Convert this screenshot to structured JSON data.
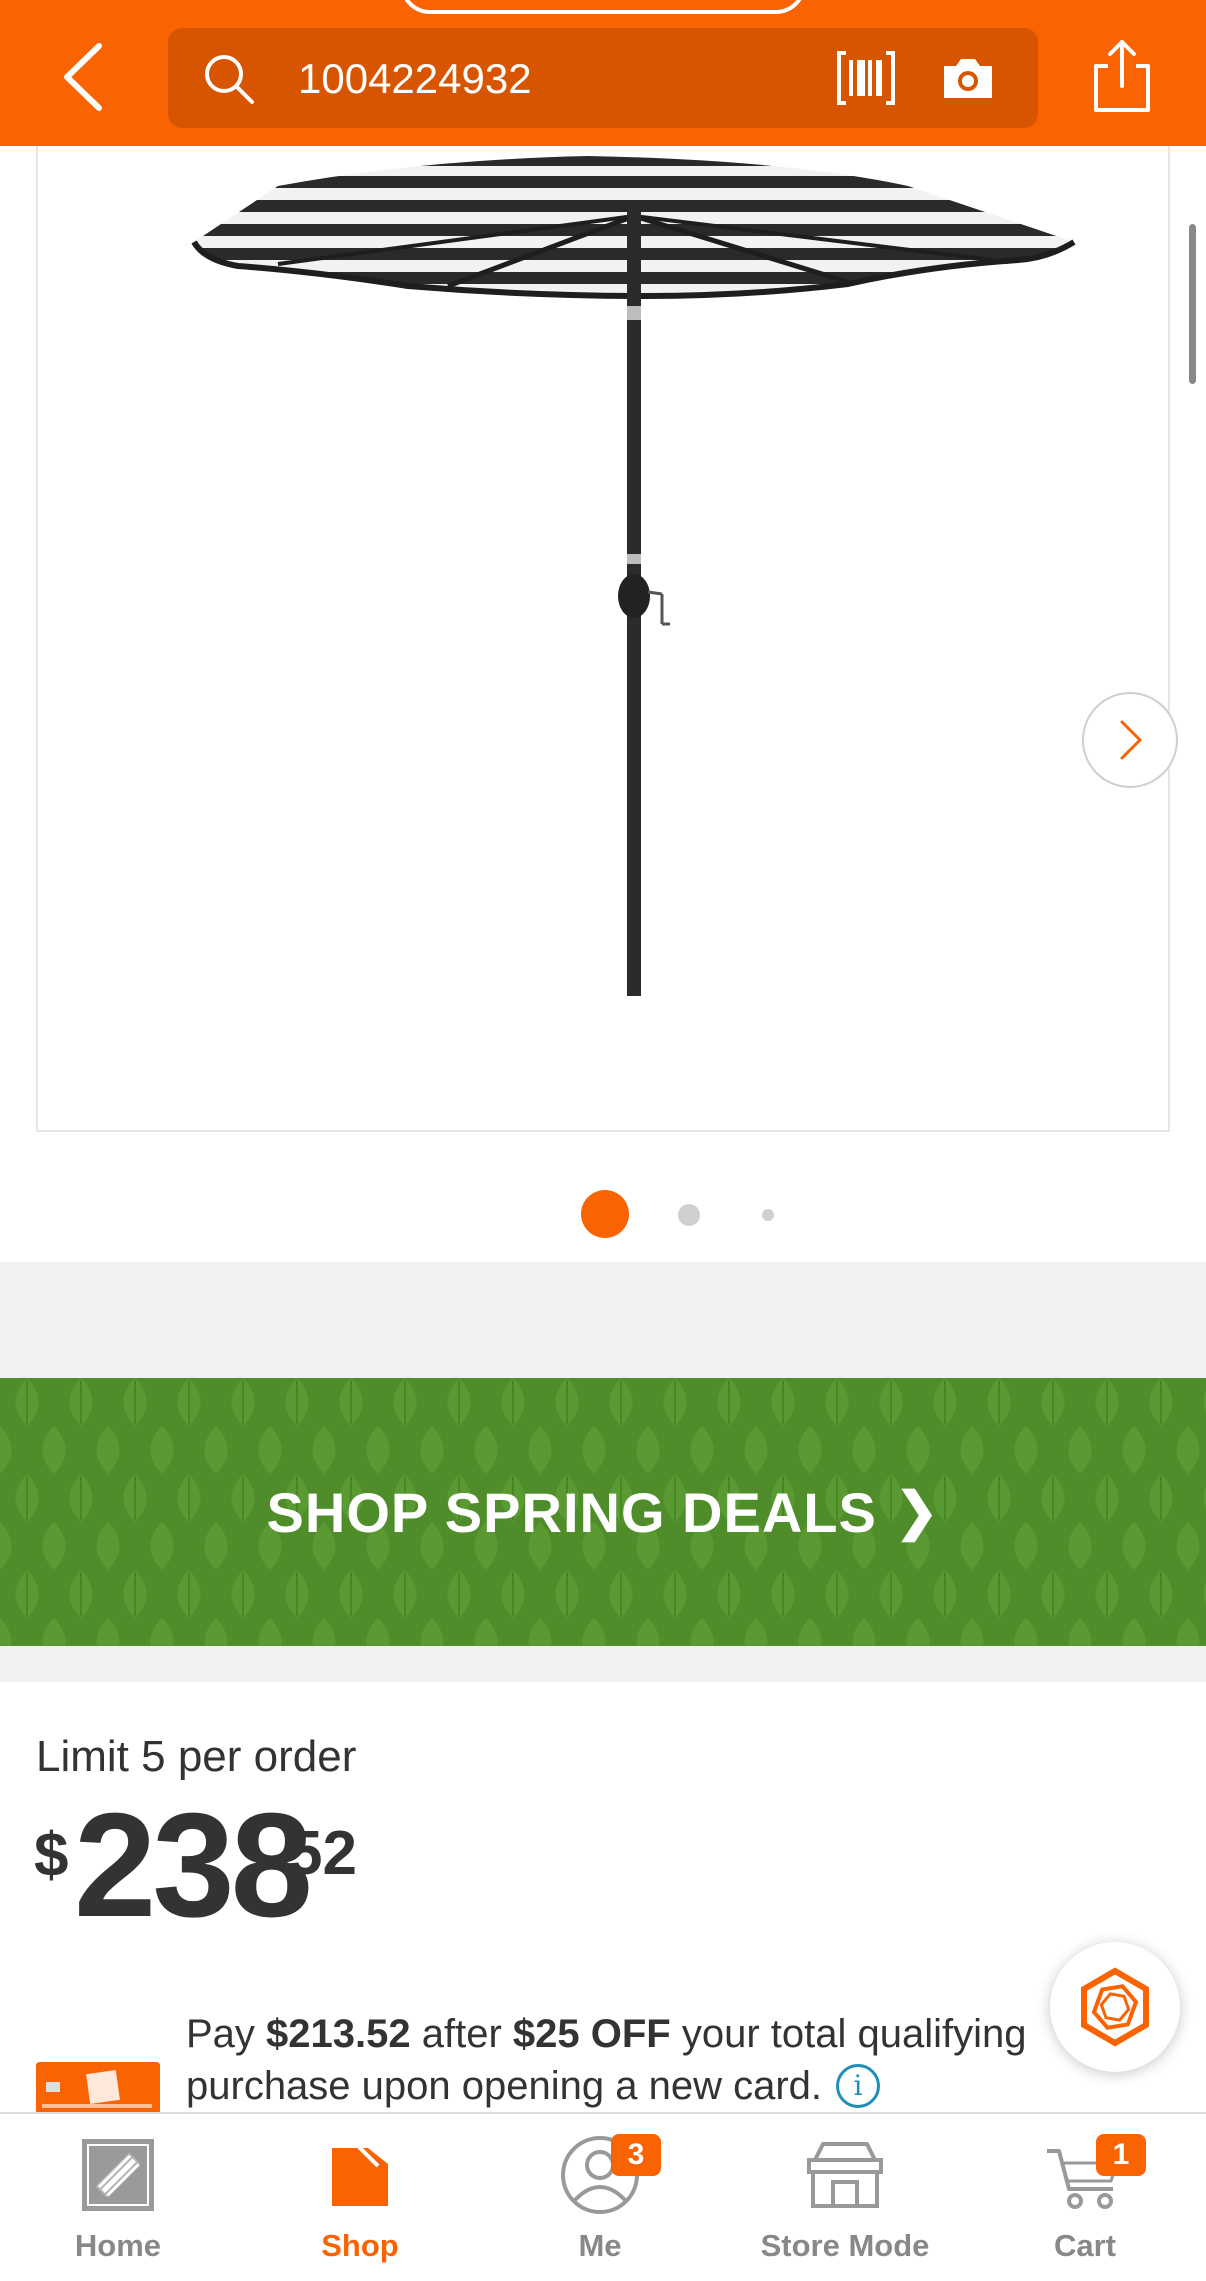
{
  "header": {
    "search_query": "1004224932",
    "accent_color": "#f96302",
    "icons": [
      "back-chevron-icon",
      "search-icon",
      "barcode-icon",
      "camera-icon",
      "share-icon"
    ]
  },
  "gallery": {
    "current_image": 1,
    "image_count": 3,
    "next_icon": "chevron-right-icon"
  },
  "promo": {
    "label": "SHOP SPRING DEALS",
    "chevron": "❯",
    "background_color": "#4f8c2a"
  },
  "price_section": {
    "limit_text": "Limit 5 per order",
    "price_symbol": "$",
    "price_dollars": "238",
    "price_cents": "52",
    "offer": {
      "pay_prefix": "Pay ",
      "pay_amount": "$213.52",
      "after_text": " after ",
      "discount": "$25 OFF",
      "tail_text": " your total qualifying",
      "line2": "purchase upon opening a new card."
    }
  },
  "bottom_nav": {
    "items": [
      {
        "label": "Home",
        "icon": "home-depot-logo-icon",
        "active": false
      },
      {
        "label": "Shop",
        "icon": "shop-tag-icon",
        "active": true
      },
      {
        "label": "Me",
        "icon": "user-icon",
        "active": false,
        "badge": "3"
      },
      {
        "label": "Store Mode",
        "icon": "store-icon",
        "active": false
      },
      {
        "label": "Cart",
        "icon": "cart-icon",
        "active": false,
        "badge": "1"
      }
    ]
  }
}
